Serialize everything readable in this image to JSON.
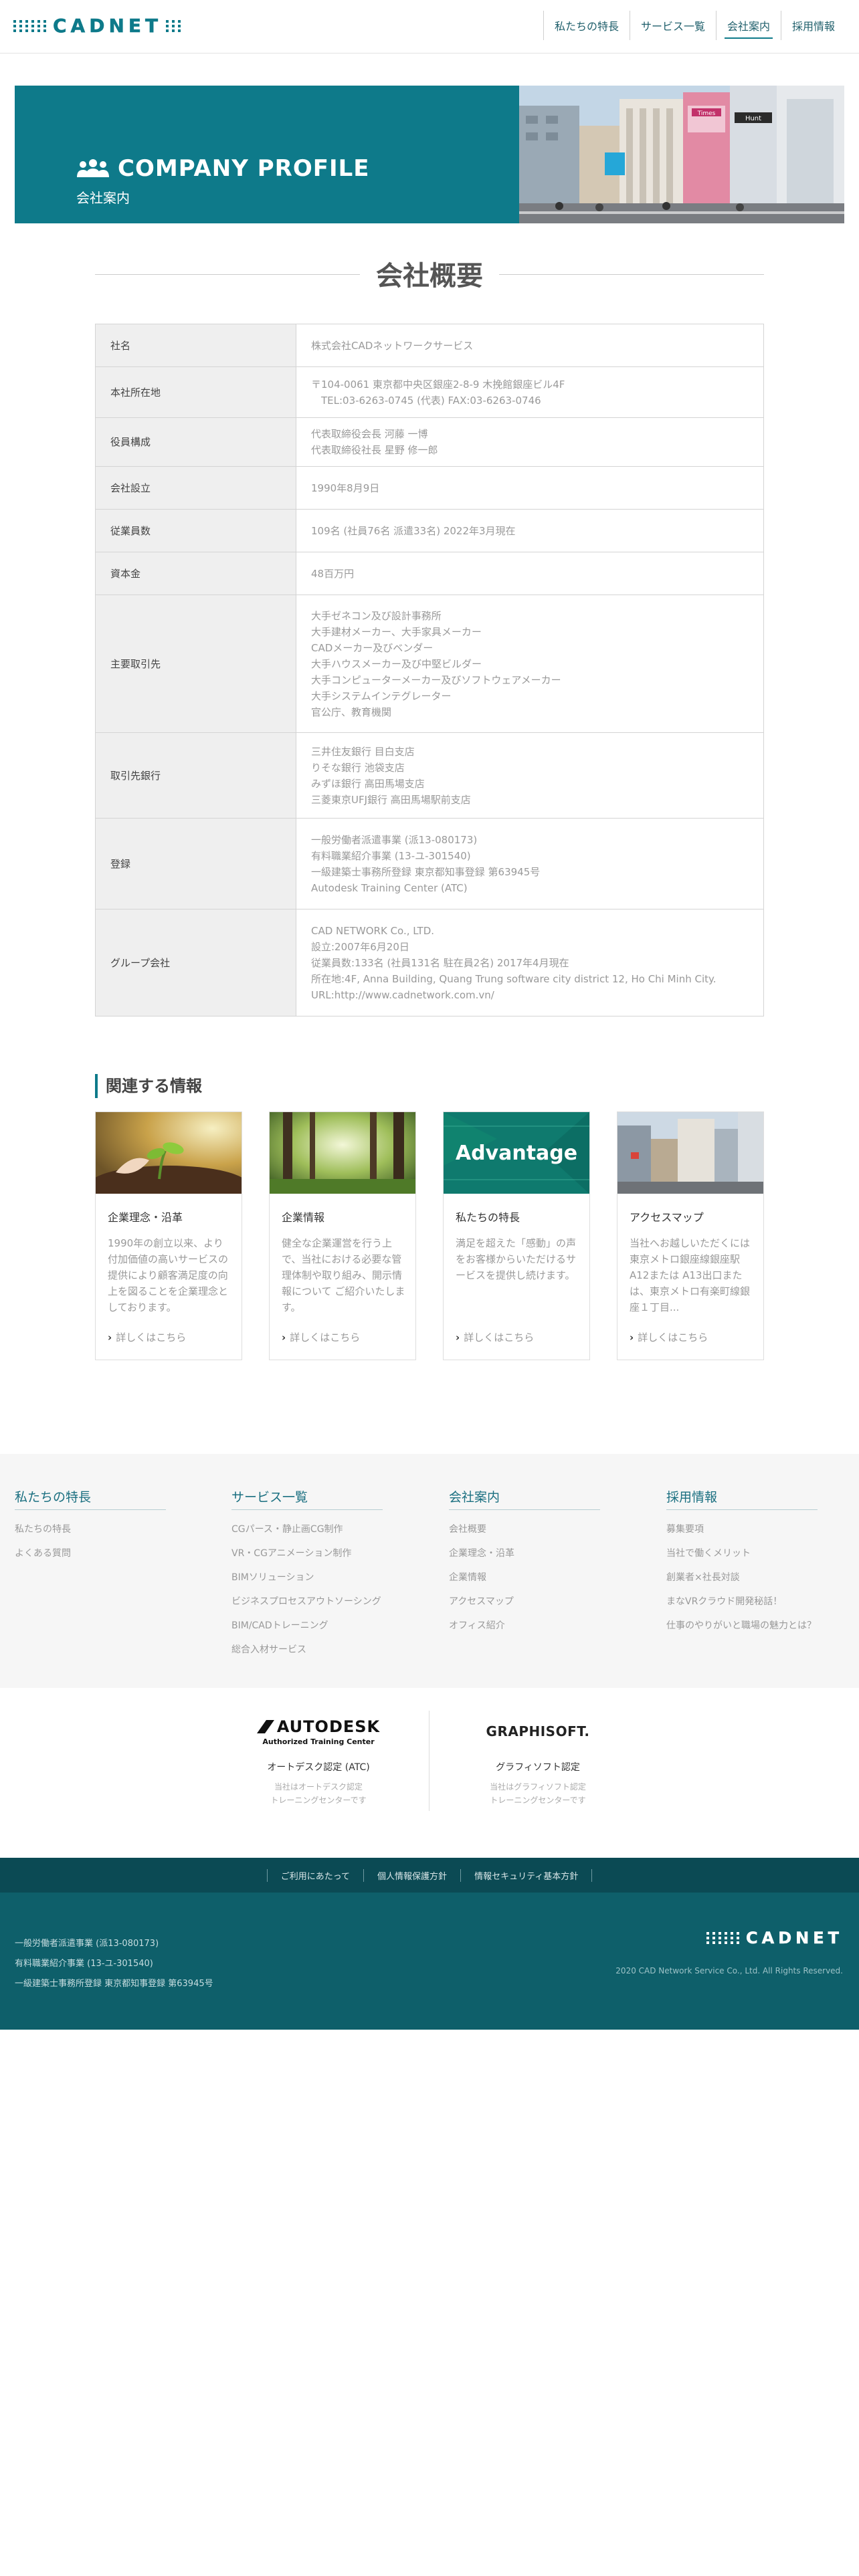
{
  "header": {
    "logo": "CADNET",
    "nav": [
      "私たちの特長",
      "サービス一覧",
      "会社案内",
      "採用情報"
    ],
    "active_index": 2
  },
  "hero": {
    "title": "COMPANY PROFILE",
    "subtitle": "会社案内",
    "photo_signs": {
      "sign1": "Times",
      "sign2": "Hunt"
    }
  },
  "section_title": "会社概要",
  "profile": [
    {
      "label": "社名",
      "lines": [
        "株式会社CADネットワークサービス"
      ]
    },
    {
      "label": "本社所在地",
      "lines": [
        "〒104-0061 東京都中央区銀座2-8-9 木挽館銀座ビル4F",
        "　TEL:03-6263-0745 (代表) FAX:03-6263-0746"
      ]
    },
    {
      "label": "役員構成",
      "lines": [
        "代表取締役会長 河藤 一博",
        "代表取締役社長 星野 修一郎"
      ]
    },
    {
      "label": "会社設立",
      "lines": [
        "1990年8月9日"
      ]
    },
    {
      "label": "従業員数",
      "lines": [
        "109名 (社員76名 派遣33名) 2022年3月現在"
      ]
    },
    {
      "label": "資本金",
      "lines": [
        "48百万円"
      ]
    },
    {
      "label": "主要取引先",
      "lines": [
        "大手ゼネコン及び設計事務所",
        "大手建材メーカー、大手家具メーカー",
        "CADメーカー及びベンダー",
        "大手ハウスメーカー及び中堅ビルダー",
        "大手コンピューターメーカー及びソフトウェアメーカー",
        "大手システムインテグレーター",
        "官公庁、教育機関"
      ]
    },
    {
      "label": "取引先銀行",
      "lines": [
        "三井住友銀行 目白支店",
        "りそな銀行 池袋支店",
        "みずほ銀行 高田馬場支店",
        "三菱東京UFJ銀行 高田馬場駅前支店"
      ]
    },
    {
      "label": "登録",
      "lines": [
        "一般労働者派遣事業 (派13-080173)",
        "有料職業紹介事業 (13-ユ-301540)",
        "一級建築士事務所登録 東京都知事登録 第63945号",
        "Autodesk Training Center (ATC)"
      ]
    },
    {
      "label": "グループ会社",
      "lines": [
        "CAD NETWORK Co., LTD.",
        "設立:2007年6月20日",
        "従業員数:133名 (社員131名 駐在員2名) 2017年4月現在",
        "所在地:4F, Anna Building, Quang Trung software city district 12, Ho Chi Minh City.",
        "URL:http://www.cadnetwork.com.vn/"
      ]
    }
  ],
  "related": {
    "title": "関連する情報",
    "more_label": "詳しくはこちら",
    "cards": [
      {
        "title": "企業理念・沿革",
        "desc": "1990年の創立以来、より付加価値の高いサービスの提供により顧客満足度の向上を図ることを企業理念としております。"
      },
      {
        "title": "企業情報",
        "desc": "健全な企業運営を行う上で、当社における必要な管理体制や取り組み、開示情報について ご紹介いたします。"
      },
      {
        "title": "私たちの特長",
        "desc": "満足を超えた「感動」の声をお客様からいただけるサービスを提供し続けます。",
        "img_text": "Advantage"
      },
      {
        "title": "アクセスマップ",
        "desc": "当社へお越しいただくには東京メトロ銀座線銀座駅A12または A13出口または、東京メトロ有楽町線銀座１丁目..."
      }
    ]
  },
  "footer_links": [
    {
      "head": "私たちの特長",
      "items": [
        "私たちの特長",
        "よくある質問"
      ]
    },
    {
      "head": "サービス一覧",
      "items": [
        "CGパース・静止画CG制作",
        "VR・CGアニメーション制作",
        "BIMソリューション",
        "ビジネスプロセスアウトソーシング",
        "BIM/CADトレーニング",
        "総合入材サービス"
      ]
    },
    {
      "head": "会社案内",
      "items": [
        "会社概要",
        "企業理念・沿革",
        "企業情報",
        "アクセスマップ",
        "オフィス紹介"
      ]
    },
    {
      "head": "採用情報",
      "items": [
        "募集要項",
        "当社で働くメリット",
        "創業者×社長対談",
        "まなVRクラウド開発秘話！",
        "仕事のやりがいと職場の魅力とは？"
      ]
    }
  ],
  "partners": [
    {
      "logo_main": "AUTODESK",
      "logo_sub": "Authorized Training Center",
      "name": "オートデスク認定 (ATC)",
      "desc": [
        "当社はオートデスク認定",
        "トレーニングセンターです"
      ]
    },
    {
      "logo_main": "GRAPHISOFT.",
      "name": "グラフィソフト認定",
      "desc": [
        "当社はグラフィソフト認定",
        "トレーニングセンターです"
      ]
    }
  ],
  "policy_links": [
    "ご利用にあたって",
    "個人情報保護方針",
    "情報セキュリティ基本方針"
  ],
  "bottom": {
    "registrations": [
      "一般労働者派遣事業 (派13-080173)",
      "有料職業紹介事業 (13-ユ-301540)",
      "一級建築士事務所登録 東京都知事登録 第63945号"
    ],
    "logo": "CADNET",
    "copyright": "2020 CAD Network Service Co., Ltd. All Rights Reserved."
  },
  "colors": {
    "teal": "#0e7a8a",
    "dark_teal": "#0b4a54",
    "footer_teal": "#0e5f6a"
  }
}
